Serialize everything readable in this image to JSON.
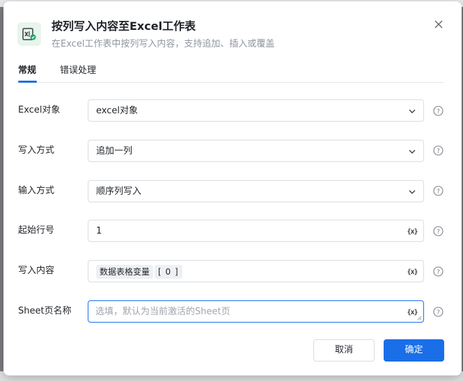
{
  "dialog": {
    "title": "按列写入内容至Excel工作表",
    "subtitle": "在Excel工作表中按列写入内容，支持追加、插入或覆盖",
    "icon": "excel-write-icon",
    "accent_color": "#1a6fe8",
    "icon_color": "#21a366"
  },
  "tabs": [
    {
      "label": "常规",
      "active": true
    },
    {
      "label": "错误处理",
      "active": false
    }
  ],
  "fields": {
    "excel_object": {
      "label": "Excel对象",
      "value": "excel对象"
    },
    "write_mode": {
      "label": "写入方式",
      "value": "追加一列"
    },
    "input_mode": {
      "label": "输入方式",
      "value": "顺序列写入"
    },
    "start_row": {
      "label": "起始行号",
      "value": "1"
    },
    "content": {
      "label": "写入内容",
      "variable": "数据表格变量",
      "index": "[ 0 ]"
    },
    "sheet_name": {
      "label": "Sheet页名称",
      "placeholder": "选填，默认为当前激活的Sheet页"
    }
  },
  "icons": {
    "variable": "{x}"
  },
  "buttons": {
    "cancel": "取消",
    "confirm": "确定"
  }
}
